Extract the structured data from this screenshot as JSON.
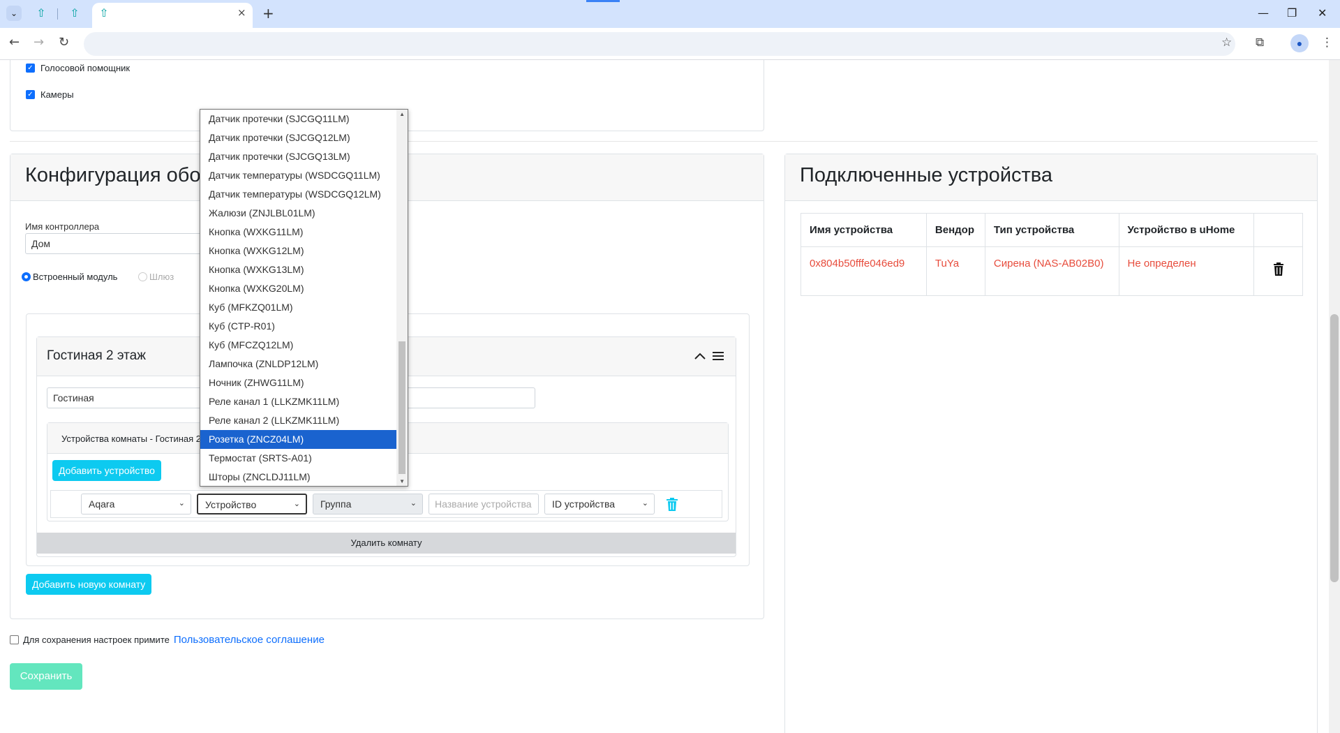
{
  "browser": {
    "tab_close": "×",
    "new_tab": "+",
    "minimize": "—",
    "restore": "❐",
    "close": "✕",
    "back": "←",
    "forward": "→",
    "reload": "↻",
    "star": "☆",
    "extensions": "⧉",
    "menu": "⋮",
    "tab_menu": "⌄",
    "tab_favicon": "⇧",
    "avatar": "●",
    "accent_color": "#d3e3fd"
  },
  "settings": {
    "voice_assistant": "Голосовой помощник",
    "cameras": "Камеры"
  },
  "config": {
    "title": "Конфигурация обо",
    "controller_name_label": "Имя контроллера",
    "controller_name_value": "Дом",
    "radio_builtin": "Встроенный модуль",
    "radio_gateway": "Шлюз",
    "room_title": "Гостиная 2 этаж",
    "room_name_value": "Гостиная",
    "room_devices_header": "Устройства комнаты - Гостиная 2",
    "add_device": "Добавить устройство",
    "vendor_select": "Aqara",
    "device_select": "Устройство",
    "group_select": "Группа",
    "device_name_placeholder": "Название устройства",
    "device_id_select": "ID устройства",
    "delete_room": "Удалить комнату",
    "add_room": "Добавить новую комнату"
  },
  "agreement": {
    "text": "Для сохранения настроек примите",
    "link": "Пользовательское соглашение"
  },
  "save_button": "Сохранить",
  "dropdown": {
    "options": [
      "Датчик протечки (SJCGQ11LM)",
      "Датчик протечки (SJCGQ12LM)",
      "Датчик протечки (SJCGQ13LM)",
      "Датчик температуры (WSDCGQ11LM)",
      "Датчик температуры (WSDCGQ12LM)",
      "Жалюзи (ZNJLBL01LM)",
      "Кнопка (WXKG11LM)",
      "Кнопка (WXKG12LM)",
      "Кнопка (WXKG13LM)",
      "Кнопка (WXKG20LM)",
      "Куб (MFKZQ01LM)",
      "Куб (CTP-R01)",
      "Куб (MFCZQ12LM)",
      "Лампочка (ZNLDP12LM)",
      "Ночник (ZHWG11LM)",
      "Реле канал 1 (LLKZMK11LM)",
      "Реле канал 2 (LLKZMK11LM)",
      "Розетка (ZNCZ04LM)",
      "Термостат (SRTS-A01)",
      "Шторы (ZNCLDJ11LM)"
    ],
    "selected": "Розетка (ZNCZ04LM)"
  },
  "connected": {
    "title": "Подключенные устройства",
    "headers": [
      "Имя устройства",
      "Вендор",
      "Тип устройства",
      "Устройство в uHome"
    ],
    "row": {
      "name": "0x804b50fffe046ed9",
      "vendor": "TuYa",
      "type": "Сирена (NAS-AB02B0)",
      "uhome": "Не определен"
    }
  },
  "icons": {
    "chevron_up": "chevron-up-icon",
    "hamburger": "menu-icon",
    "trash": "trash-icon"
  }
}
